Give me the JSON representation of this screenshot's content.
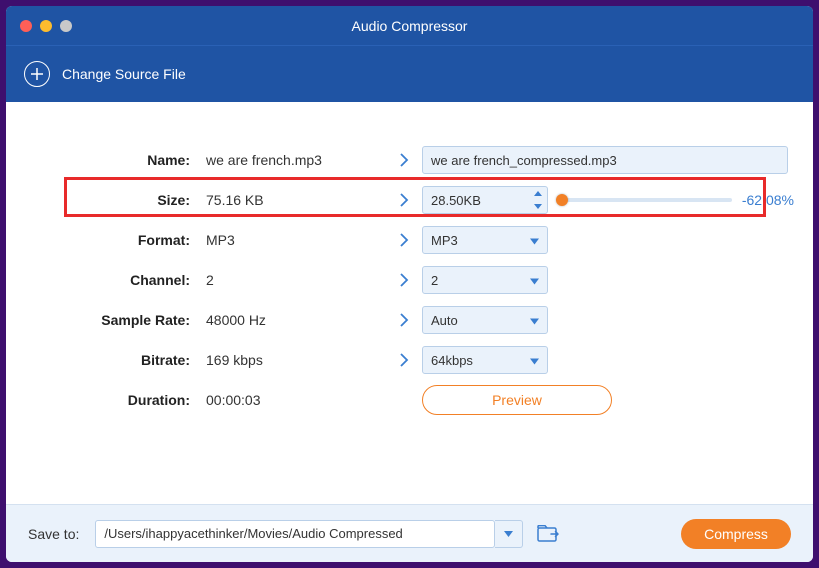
{
  "window": {
    "title": "Audio Compressor"
  },
  "subbar": {
    "change_source": "Change Source File"
  },
  "rows": {
    "name": {
      "label": "Name:",
      "src": "we are french.mp3",
      "out": "we are french_compressed.mp3"
    },
    "size": {
      "label": "Size:",
      "src": "75.16 KB",
      "out": "28.50KB",
      "pct": "-62.08%"
    },
    "format": {
      "label": "Format:",
      "src": "MP3",
      "out": "MP3"
    },
    "channel": {
      "label": "Channel:",
      "src": "2",
      "out": "2"
    },
    "sample_rate": {
      "label": "Sample Rate:",
      "src": "48000 Hz",
      "out": "Auto"
    },
    "bitrate": {
      "label": "Bitrate:",
      "src": "169 kbps",
      "out": "64kbps"
    },
    "duration": {
      "label": "Duration:",
      "src": "00:00:03"
    }
  },
  "preview_label": "Preview",
  "footer": {
    "save_to_label": "Save to:",
    "path": "/Users/ihappyacethinker/Movies/Audio Compressed",
    "compress_label": "Compress"
  }
}
